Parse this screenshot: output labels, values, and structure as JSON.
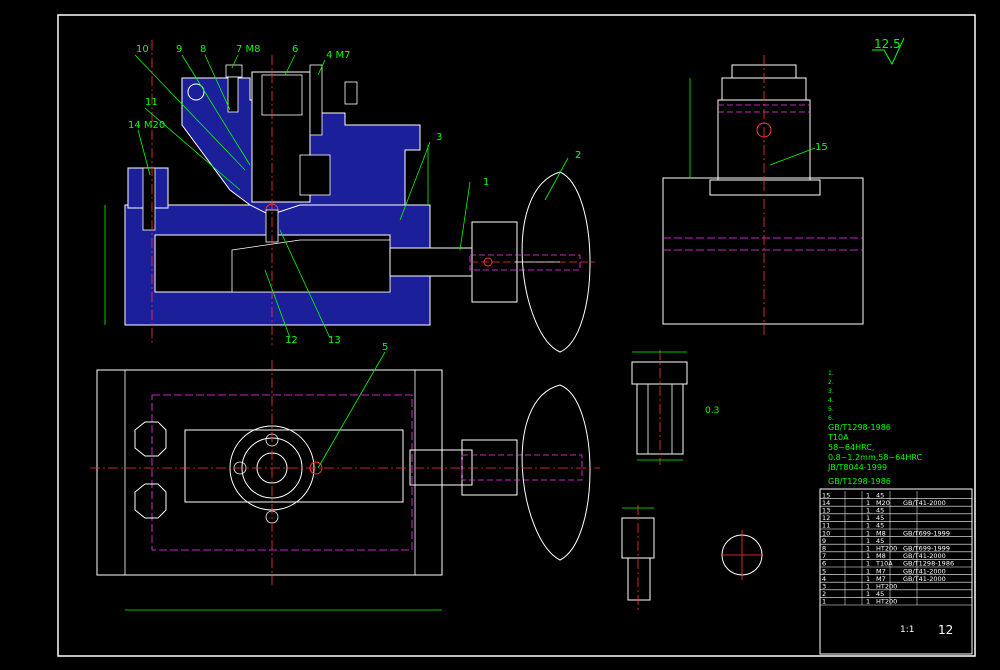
{
  "labels": {
    "n10": "10",
    "n9": "9",
    "n8": "8",
    "n7": "7 M8",
    "n6": "6",
    "n4": "4 M7",
    "n11": "11",
    "n14": "14 M20",
    "n3": "3",
    "n2": "2",
    "n1": "1",
    "n12": "12",
    "n13": "13",
    "n5": "5",
    "n15": "15"
  },
  "roughness": "12.5",
  "detail": {
    "chamfer": "0.3"
  },
  "notes": {
    "lines": [
      "1.",
      "2.",
      "3.",
      "4.",
      "5.",
      "6.",
      "GB/T1298-1986",
      "T10A",
      "58~64HRC,",
      "0.8~1.2mm,58~64HRC",
      "JB/T8044-1999",
      "GB/T1298-1986"
    ]
  },
  "bom": {
    "rows": [
      {
        "no": "15",
        "qty": "1",
        "mat": "45",
        "std": ""
      },
      {
        "no": "14",
        "qty": "1",
        "mat": "M20",
        "std": "GB/T41-2000"
      },
      {
        "no": "13",
        "qty": "1",
        "mat": "45",
        "std": ""
      },
      {
        "no": "12",
        "qty": "1",
        "mat": "45",
        "std": ""
      },
      {
        "no": "11",
        "qty": "1",
        "mat": "45",
        "std": ""
      },
      {
        "no": "10",
        "qty": "1",
        "mat": "M8",
        "std": "GB/T699-1999"
      },
      {
        "no": "9",
        "qty": "1",
        "mat": "45",
        "std": ""
      },
      {
        "no": "8",
        "qty": "1",
        "mat": "HT200",
        "std": "GB/T699-1999"
      },
      {
        "no": "7",
        "qty": "1",
        "mat": "M8",
        "std": "GB/T41-2000"
      },
      {
        "no": "6",
        "qty": "1",
        "mat": "T10A",
        "std": "GB/T1298-1986"
      },
      {
        "no": "5",
        "qty": "1",
        "mat": "M7",
        "std": "GB/T41-2000"
      },
      {
        "no": "4",
        "qty": "1",
        "mat": "M7",
        "std": "GB/T41-2000"
      },
      {
        "no": "3",
        "qty": "1",
        "mat": "HT200",
        "std": ""
      },
      {
        "no": "2",
        "qty": "1",
        "mat": "45",
        "std": ""
      },
      {
        "no": "1",
        "qty": "1",
        "mat": "HT200",
        "std": ""
      }
    ],
    "scale": "1:1",
    "sheet": "12"
  }
}
